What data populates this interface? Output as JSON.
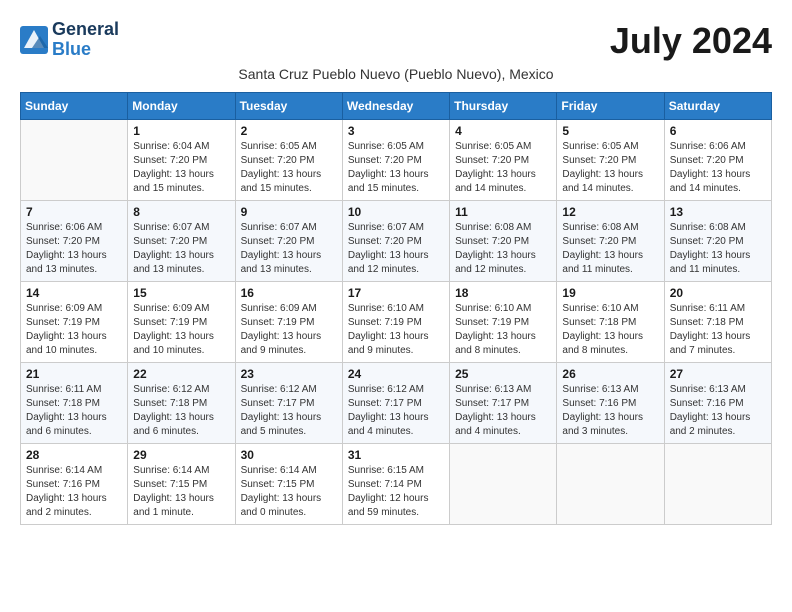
{
  "logo": {
    "line1": "General",
    "line2": "Blue"
  },
  "title": "July 2024",
  "location": "Santa Cruz Pueblo Nuevo (Pueblo Nuevo), Mexico",
  "days_of_week": [
    "Sunday",
    "Monday",
    "Tuesday",
    "Wednesday",
    "Thursday",
    "Friday",
    "Saturday"
  ],
  "weeks": [
    [
      {
        "num": "",
        "info": ""
      },
      {
        "num": "1",
        "info": "Sunrise: 6:04 AM\nSunset: 7:20 PM\nDaylight: 13 hours\nand 15 minutes."
      },
      {
        "num": "2",
        "info": "Sunrise: 6:05 AM\nSunset: 7:20 PM\nDaylight: 13 hours\nand 15 minutes."
      },
      {
        "num": "3",
        "info": "Sunrise: 6:05 AM\nSunset: 7:20 PM\nDaylight: 13 hours\nand 15 minutes."
      },
      {
        "num": "4",
        "info": "Sunrise: 6:05 AM\nSunset: 7:20 PM\nDaylight: 13 hours\nand 14 minutes."
      },
      {
        "num": "5",
        "info": "Sunrise: 6:05 AM\nSunset: 7:20 PM\nDaylight: 13 hours\nand 14 minutes."
      },
      {
        "num": "6",
        "info": "Sunrise: 6:06 AM\nSunset: 7:20 PM\nDaylight: 13 hours\nand 14 minutes."
      }
    ],
    [
      {
        "num": "7",
        "info": "Sunrise: 6:06 AM\nSunset: 7:20 PM\nDaylight: 13 hours\nand 13 minutes."
      },
      {
        "num": "8",
        "info": "Sunrise: 6:07 AM\nSunset: 7:20 PM\nDaylight: 13 hours\nand 13 minutes."
      },
      {
        "num": "9",
        "info": "Sunrise: 6:07 AM\nSunset: 7:20 PM\nDaylight: 13 hours\nand 13 minutes."
      },
      {
        "num": "10",
        "info": "Sunrise: 6:07 AM\nSunset: 7:20 PM\nDaylight: 13 hours\nand 12 minutes."
      },
      {
        "num": "11",
        "info": "Sunrise: 6:08 AM\nSunset: 7:20 PM\nDaylight: 13 hours\nand 12 minutes."
      },
      {
        "num": "12",
        "info": "Sunrise: 6:08 AM\nSunset: 7:20 PM\nDaylight: 13 hours\nand 11 minutes."
      },
      {
        "num": "13",
        "info": "Sunrise: 6:08 AM\nSunset: 7:20 PM\nDaylight: 13 hours\nand 11 minutes."
      }
    ],
    [
      {
        "num": "14",
        "info": "Sunrise: 6:09 AM\nSunset: 7:19 PM\nDaylight: 13 hours\nand 10 minutes."
      },
      {
        "num": "15",
        "info": "Sunrise: 6:09 AM\nSunset: 7:19 PM\nDaylight: 13 hours\nand 10 minutes."
      },
      {
        "num": "16",
        "info": "Sunrise: 6:09 AM\nSunset: 7:19 PM\nDaylight: 13 hours\nand 9 minutes."
      },
      {
        "num": "17",
        "info": "Sunrise: 6:10 AM\nSunset: 7:19 PM\nDaylight: 13 hours\nand 9 minutes."
      },
      {
        "num": "18",
        "info": "Sunrise: 6:10 AM\nSunset: 7:19 PM\nDaylight: 13 hours\nand 8 minutes."
      },
      {
        "num": "19",
        "info": "Sunrise: 6:10 AM\nSunset: 7:18 PM\nDaylight: 13 hours\nand 8 minutes."
      },
      {
        "num": "20",
        "info": "Sunrise: 6:11 AM\nSunset: 7:18 PM\nDaylight: 13 hours\nand 7 minutes."
      }
    ],
    [
      {
        "num": "21",
        "info": "Sunrise: 6:11 AM\nSunset: 7:18 PM\nDaylight: 13 hours\nand 6 minutes."
      },
      {
        "num": "22",
        "info": "Sunrise: 6:12 AM\nSunset: 7:18 PM\nDaylight: 13 hours\nand 6 minutes."
      },
      {
        "num": "23",
        "info": "Sunrise: 6:12 AM\nSunset: 7:17 PM\nDaylight: 13 hours\nand 5 minutes."
      },
      {
        "num": "24",
        "info": "Sunrise: 6:12 AM\nSunset: 7:17 PM\nDaylight: 13 hours\nand 4 minutes."
      },
      {
        "num": "25",
        "info": "Sunrise: 6:13 AM\nSunset: 7:17 PM\nDaylight: 13 hours\nand 4 minutes."
      },
      {
        "num": "26",
        "info": "Sunrise: 6:13 AM\nSunset: 7:16 PM\nDaylight: 13 hours\nand 3 minutes."
      },
      {
        "num": "27",
        "info": "Sunrise: 6:13 AM\nSunset: 7:16 PM\nDaylight: 13 hours\nand 2 minutes."
      }
    ],
    [
      {
        "num": "28",
        "info": "Sunrise: 6:14 AM\nSunset: 7:16 PM\nDaylight: 13 hours\nand 2 minutes."
      },
      {
        "num": "29",
        "info": "Sunrise: 6:14 AM\nSunset: 7:15 PM\nDaylight: 13 hours\nand 1 minute."
      },
      {
        "num": "30",
        "info": "Sunrise: 6:14 AM\nSunset: 7:15 PM\nDaylight: 13 hours\nand 0 minutes."
      },
      {
        "num": "31",
        "info": "Sunrise: 6:15 AM\nSunset: 7:14 PM\nDaylight: 12 hours\nand 59 minutes."
      },
      {
        "num": "",
        "info": ""
      },
      {
        "num": "",
        "info": ""
      },
      {
        "num": "",
        "info": ""
      }
    ]
  ]
}
